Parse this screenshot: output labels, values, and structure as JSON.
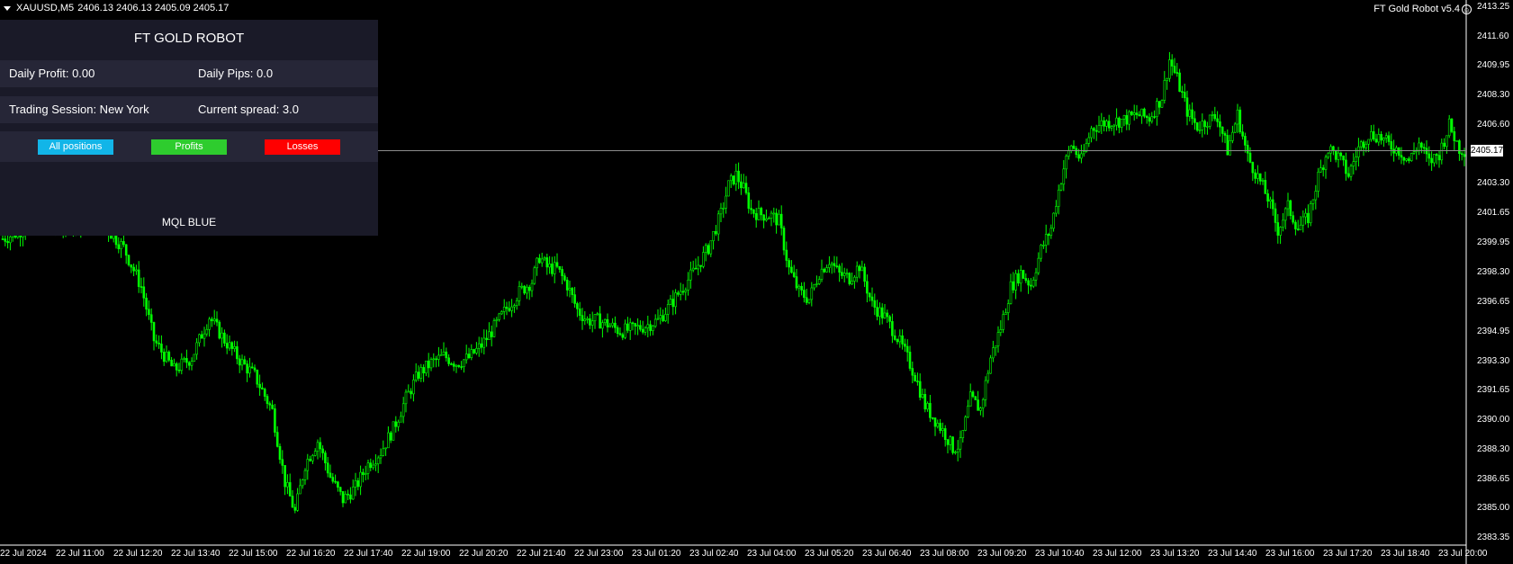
{
  "header": {
    "symbol": "XAUUSD,M5",
    "ohlc": "2406.13 2406.13 2405.09 2405.17",
    "robot_label": "FT Gold Robot v5.4"
  },
  "panel": {
    "title": "FT GOLD ROBOT",
    "daily_profit_label": "Daily Profit: 0.00",
    "daily_pips_label": "Daily Pips:  0.0",
    "session_label": "Trading Session: New York",
    "spread_label": "Current spread: 3.0",
    "buttons": [
      {
        "label": "All positions",
        "color": "#12b5e8"
      },
      {
        "label": "Profits",
        "color": "#2ecc2e"
      },
      {
        "label": "Losses",
        "color": "#ff0000"
      }
    ],
    "footer": "MQL BLUE",
    "background": "#1a1a28",
    "row_background": "#262637"
  },
  "current_price": "2405.17",
  "candle_color": "#00ff00",
  "y_axis_labels": [
    "2413.25",
    "2411.60",
    "2409.95",
    "2408.30",
    "2406.60",
    "2403.30",
    "2401.65",
    "2399.95",
    "2398.30",
    "2396.65",
    "2394.95",
    "2393.30",
    "2391.65",
    "2390.00",
    "2388.30",
    "2386.65",
    "2385.00",
    "2383.35"
  ],
  "x_axis_labels": [
    "22 Jul 2024",
    "22 Jul 11:00",
    "22 Jul 12:20",
    "22 Jul 13:40",
    "22 Jul 15:00",
    "22 Jul 16:20",
    "22 Jul 17:40",
    "22 Jul 19:00",
    "22 Jul 20:20",
    "22 Jul 21:40",
    "22 Jul 23:00",
    "23 Jul 01:20",
    "23 Jul 02:40",
    "23 Jul 04:00",
    "23 Jul 05:20",
    "23 Jul 06:40",
    "23 Jul 08:00",
    "23 Jul 09:20",
    "23 Jul 10:40",
    "23 Jul 12:00",
    "23 Jul 13:20",
    "23 Jul 14:40",
    "23 Jul 16:00",
    "23 Jul 17:20",
    "23 Jul 18:40",
    "23 Jul 20:00"
  ],
  "chart_data": {
    "type": "candlestick",
    "ylim": [
      2383.35,
      2413.25
    ],
    "current_price": 2405.17,
    "close_path": [
      [
        0,
        2400.2
      ],
      [
        5,
        2400.5
      ],
      [
        10,
        2400.9
      ],
      [
        20,
        2400.8
      ],
      [
        30,
        2401.2
      ],
      [
        40,
        2401.0
      ],
      [
        48,
        2399.7
      ],
      [
        55,
        2397.5
      ],
      [
        60,
        2394.5
      ],
      [
        68,
        2392.8
      ],
      [
        75,
        2393.5
      ],
      [
        82,
        2395.8
      ],
      [
        88,
        2394.5
      ],
      [
        95,
        2393.2
      ],
      [
        100,
        2392.5
      ],
      [
        107,
        2390.5
      ],
      [
        112,
        2386.5
      ],
      [
        116,
        2384.8
      ],
      [
        120,
        2387.5
      ],
      [
        125,
        2388.8
      ],
      [
        130,
        2386.8
      ],
      [
        135,
        2385.5
      ],
      [
        140,
        2386.2
      ],
      [
        145,
        2387.5
      ],
      [
        150,
        2388.2
      ],
      [
        155,
        2389.5
      ],
      [
        160,
        2391.2
      ],
      [
        165,
        2392.6
      ],
      [
        170,
        2393.2
      ],
      [
        175,
        2393.6
      ],
      [
        180,
        2393.2
      ],
      [
        185,
        2393.5
      ],
      [
        190,
        2394.2
      ],
      [
        195,
        2395.2
      ],
      [
        200,
        2396.3
      ],
      [
        205,
        2397.2
      ],
      [
        210,
        2397.8
      ],
      [
        213,
        2399.2
      ],
      [
        216,
        2398.6
      ],
      [
        220,
        2398.5
      ],
      [
        224,
        2397.6
      ],
      [
        228,
        2396.2
      ],
      [
        232,
        2395.6
      ],
      [
        236,
        2395.6
      ],
      [
        240,
        2395.4
      ],
      [
        245,
        2395.0
      ],
      [
        250,
        2395.1
      ],
      [
        255,
        2395.3
      ],
      [
        260,
        2395.6
      ],
      [
        265,
        2396.5
      ],
      [
        270,
        2397.5
      ],
      [
        275,
        2398.5
      ],
      [
        280,
        2399.7
      ],
      [
        285,
        2401.6
      ],
      [
        288,
        2403.2
      ],
      [
        291,
        2403.8
      ],
      [
        294,
        2403.0
      ],
      [
        297,
        2401.8
      ],
      [
        300,
        2401.6
      ],
      [
        305,
        2401.5
      ],
      [
        308,
        2401.2
      ],
      [
        312,
        2398.5
      ],
      [
        316,
        2397.2
      ],
      [
        320,
        2396.8
      ],
      [
        324,
        2398.3
      ],
      [
        328,
        2399.0
      ],
      [
        332,
        2398.2
      ],
      [
        336,
        2398.0
      ],
      [
        340,
        2398.7
      ],
      [
        345,
        2396.5
      ],
      [
        350,
        2395.8
      ],
      [
        354,
        2394.9
      ],
      [
        358,
        2393.8
      ],
      [
        362,
        2392.5
      ],
      [
        366,
        2390.8
      ],
      [
        370,
        2390.0
      ],
      [
        374,
        2389.2
      ],
      [
        377,
        2388.4
      ],
      [
        380,
        2388.6
      ],
      [
        384,
        2391.2
      ],
      [
        388,
        2390.6
      ],
      [
        392,
        2393.5
      ],
      [
        396,
        2395.2
      ],
      [
        400,
        2397.5
      ],
      [
        404,
        2398.3
      ],
      [
        408,
        2397.6
      ],
      [
        412,
        2399.6
      ],
      [
        416,
        2400.8
      ],
      [
        418,
        2402.3
      ],
      [
        421,
        2404.2
      ],
      [
        424,
        2405.5
      ],
      [
        428,
        2404.6
      ],
      [
        432,
        2406.4
      ],
      [
        436,
        2406.7
      ],
      [
        440,
        2406.8
      ],
      [
        445,
        2406.9
      ],
      [
        450,
        2407.2
      ],
      [
        455,
        2407.0
      ],
      [
        460,
        2408.2
      ],
      [
        463,
        2410.3
      ],
      [
        466,
        2409.2
      ],
      [
        470,
        2407.4
      ],
      [
        474,
        2406.5
      ],
      [
        478,
        2406.9
      ],
      [
        482,
        2407.1
      ],
      [
        486,
        2405.2
      ],
      [
        490,
        2407.2
      ],
      [
        494,
        2404.8
      ],
      [
        498,
        2403.7
      ],
      [
        502,
        2402.5
      ],
      [
        506,
        2400.7
      ],
      [
        510,
        2402.0
      ],
      [
        514,
        2400.8
      ],
      [
        518,
        2401.4
      ],
      [
        522,
        2403.7
      ],
      [
        526,
        2405.3
      ],
      [
        530,
        2404.8
      ],
      [
        534,
        2403.8
      ],
      [
        538,
        2405.3
      ],
      [
        542,
        2406.1
      ],
      [
        546,
        2406.0
      ],
      [
        550,
        2405.5
      ],
      [
        554,
        2405.2
      ],
      [
        558,
        2404.6
      ],
      [
        562,
        2405.6
      ],
      [
        566,
        2404.5
      ],
      [
        570,
        2405.0
      ],
      [
        574,
        2406.6
      ],
      [
        578,
        2405.3
      ],
      [
        580,
        2405.2
      ]
    ]
  }
}
